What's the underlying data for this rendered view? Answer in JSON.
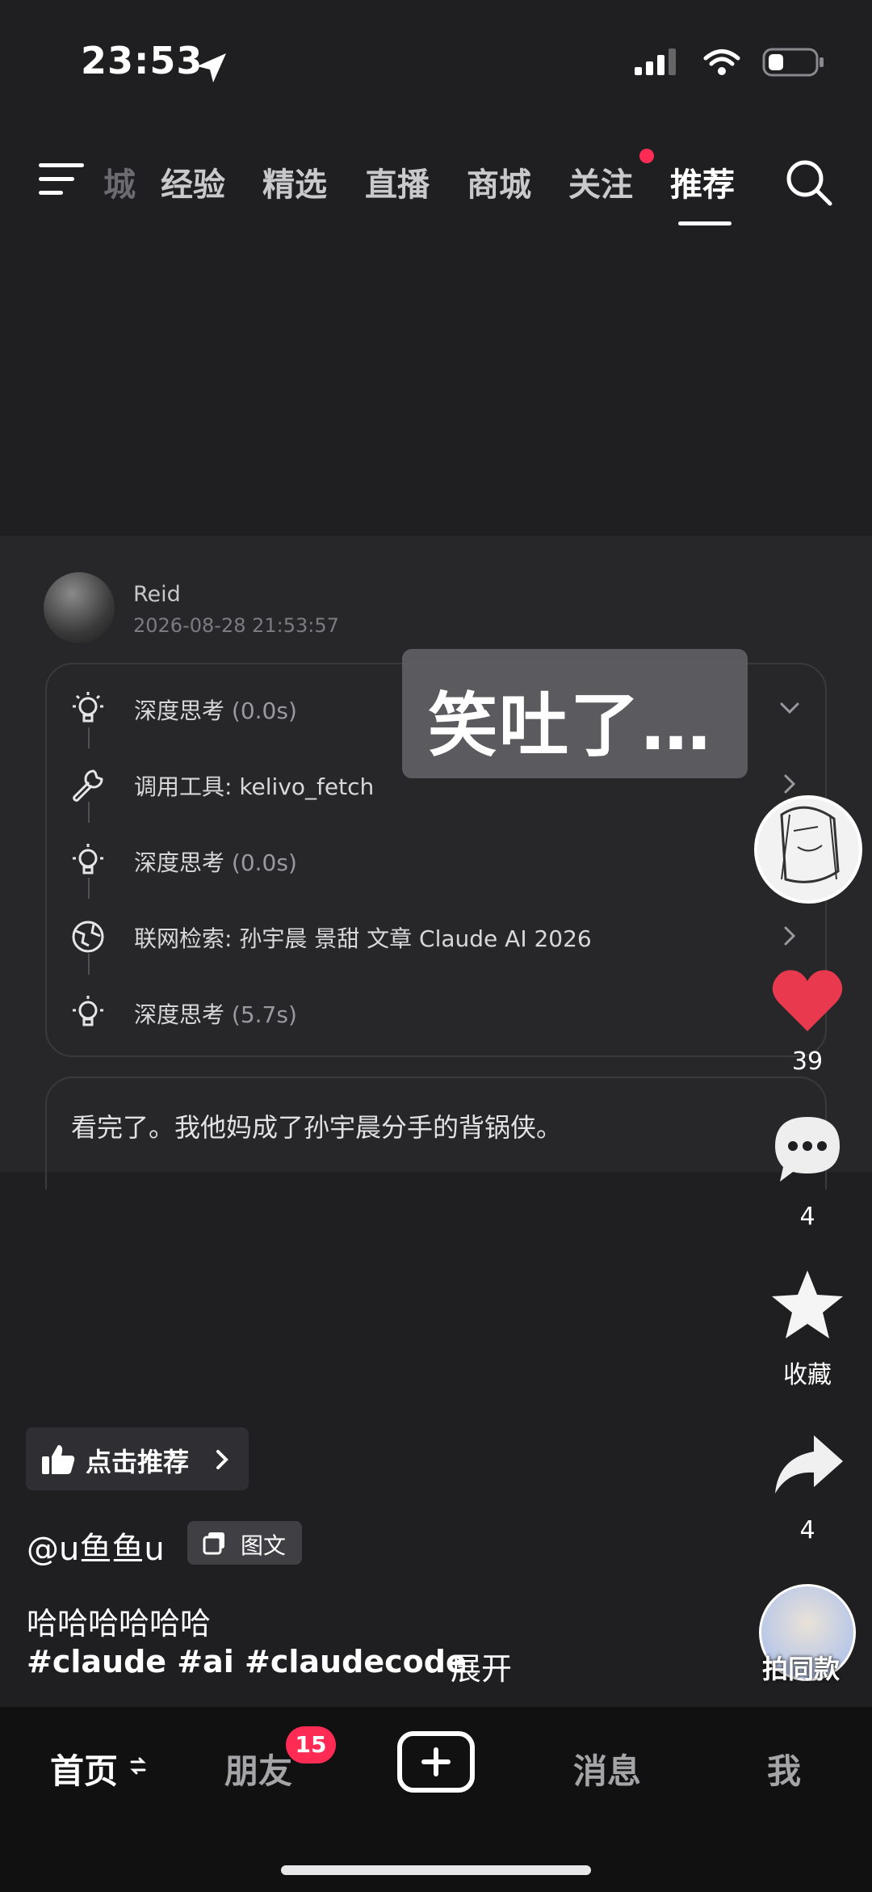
{
  "status": {
    "time": "23:53"
  },
  "topnav": {
    "tabs": [
      {
        "label": "城"
      },
      {
        "label": "经验"
      },
      {
        "label": "精选"
      },
      {
        "label": "直播"
      },
      {
        "label": "商城"
      },
      {
        "label": "关注"
      },
      {
        "label": "推荐"
      }
    ],
    "active_tab": "推荐"
  },
  "post": {
    "username": "Reid",
    "date": "2026-08-28 21:53:57",
    "steps": [
      {
        "icon": "bulb-icon",
        "label": "深度思考",
        "detail": "(0.0s)"
      },
      {
        "icon": "wrench-icon",
        "label": "调用工具: kelivo_fetch",
        "detail": ""
      },
      {
        "icon": "bulb-icon",
        "label": "深度思考",
        "detail": "(0.0s)"
      },
      {
        "icon": "globe-icon",
        "label": "联网检索: 孙宇晨 景甜 文章 Claude AI 2026",
        "detail": ""
      },
      {
        "icon": "bulb-icon",
        "label": "深度思考",
        "detail": "(5.7s)"
      }
    ],
    "reply": "看完了。我他妈成了孙宇晨分手的背锅侠。"
  },
  "overlay": {
    "text": "笑吐了…"
  },
  "rail": {
    "likes": "39",
    "comments": "4",
    "favorite_label": "收藏",
    "shares": "4"
  },
  "info": {
    "recommend_label": "点击推荐",
    "author": "@u鱼鱼u",
    "type_label": "图文",
    "caption": "哈哈哈哈哈哈",
    "tags": "#claude #ai #claudecode",
    "expand": "展开",
    "same_label": "拍同款"
  },
  "bottom_nav": {
    "home": "首页",
    "friends": "朋友",
    "friends_badge": "15",
    "messages": "消息",
    "me": "我"
  },
  "colors": {
    "accent": "#fe2c55",
    "like": "#e8394f",
    "background": "#1f1f21"
  }
}
